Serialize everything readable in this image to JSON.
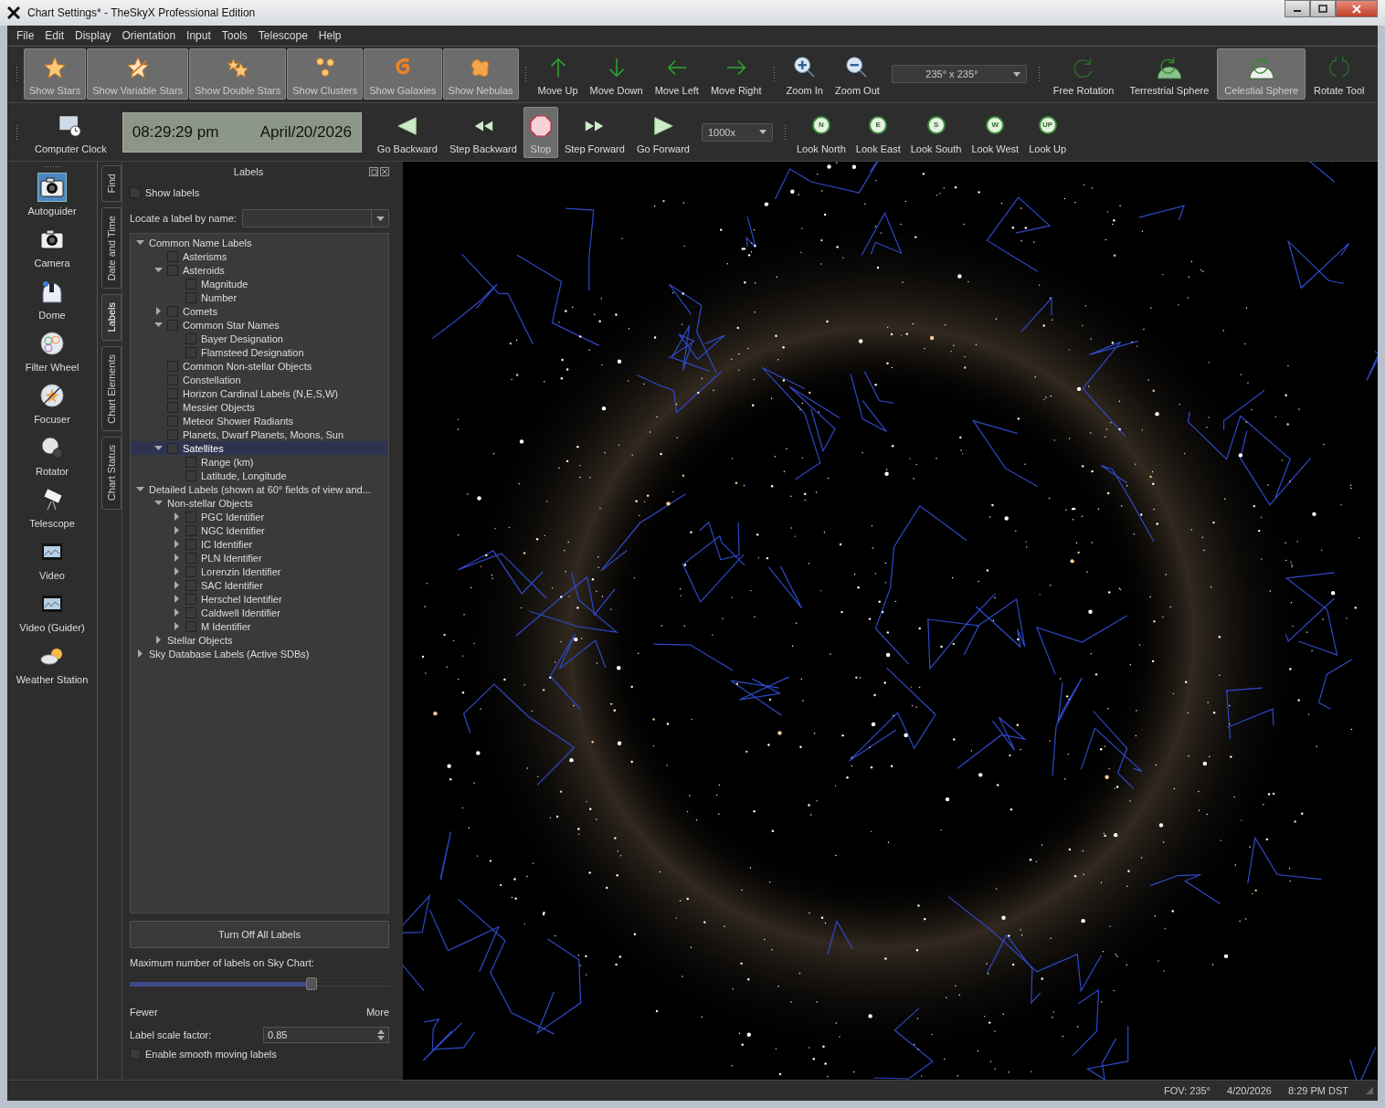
{
  "window": {
    "title": "Chart Settings* - TheSkyX Professional Edition"
  },
  "menu": [
    {
      "label": "File"
    },
    {
      "label": "Edit"
    },
    {
      "label": "Display"
    },
    {
      "label": "Orientation"
    },
    {
      "label": "Input"
    },
    {
      "label": "Tools"
    },
    {
      "label": "Telescope"
    },
    {
      "label": "Help"
    }
  ],
  "display_toggles": [
    {
      "label": "Show Stars",
      "kind": "star",
      "on": true
    },
    {
      "label": "Show Variable Stars",
      "kind": "variable",
      "on": true
    },
    {
      "label": "Show Double Stars",
      "kind": "double",
      "on": true
    },
    {
      "label": "Show Clusters",
      "kind": "cluster",
      "on": true
    },
    {
      "label": "Show Galaxies",
      "kind": "galaxy",
      "on": true
    },
    {
      "label": "Show Nebulas",
      "kind": "nebula",
      "on": true
    }
  ],
  "move_buttons": [
    {
      "label": "Move Up",
      "kind": "up"
    },
    {
      "label": "Move Down",
      "kind": "down"
    },
    {
      "label": "Move Left",
      "kind": "left"
    },
    {
      "label": "Move Right",
      "kind": "right"
    }
  ],
  "zoom_buttons": [
    {
      "label": "Zoom In",
      "kind": "in"
    },
    {
      "label": "Zoom Out",
      "kind": "out"
    }
  ],
  "fov_dropdown": {
    "value": "235° x 235°"
  },
  "rotation_modes": [
    {
      "label": "Free Rotation",
      "kind": "free",
      "selected": false
    },
    {
      "label": "Terrestrial Sphere",
      "kind": "sphere",
      "selected": false
    },
    {
      "label": "Celestial Sphere",
      "kind": "sphere",
      "selected": true
    },
    {
      "label": "Rotate Tool",
      "kind": "tool",
      "selected": false
    }
  ],
  "clock": {
    "label": "Computer Clock",
    "time": "08:29:29 pm",
    "date": "April/20/2026"
  },
  "playback": [
    {
      "label": "Go Backward",
      "kind": "back",
      "selected": false
    },
    {
      "label": "Step Backward",
      "kind": "stepback",
      "selected": false
    },
    {
      "label": "Stop",
      "kind": "stop",
      "selected": true
    },
    {
      "label": "Step Forward",
      "kind": "stepfwd",
      "selected": false
    },
    {
      "label": "Go Forward",
      "kind": "fwd",
      "selected": false
    }
  ],
  "rate_dropdown": {
    "value": "1000x"
  },
  "look_buttons": [
    {
      "label": "Look North",
      "badge": "N"
    },
    {
      "label": "Look East",
      "badge": "E"
    },
    {
      "label": "Look South",
      "badge": "S"
    },
    {
      "label": "Look West",
      "badge": "W"
    },
    {
      "label": "Look Up",
      "badge": "UP"
    }
  ],
  "side_tools": [
    {
      "label": "Autoguider",
      "kind": "camera",
      "selected": true
    },
    {
      "label": "Camera",
      "kind": "camera",
      "selected": false
    },
    {
      "label": "Dome",
      "kind": "dome",
      "selected": false
    },
    {
      "label": "Filter Wheel",
      "kind": "filter",
      "selected": false
    },
    {
      "label": "Focuser",
      "kind": "focuser",
      "selected": false
    },
    {
      "label": "Rotator",
      "kind": "rotator",
      "selected": false
    },
    {
      "label": "Telescope",
      "kind": "telescope",
      "selected": false
    },
    {
      "label": "Video",
      "kind": "video",
      "selected": false
    },
    {
      "label": "Video (Guider)",
      "kind": "video",
      "selected": false
    },
    {
      "label": "Weather Station",
      "kind": "weather",
      "selected": false
    }
  ],
  "vertical_tabs": [
    {
      "label": "Find",
      "selected": false
    },
    {
      "label": "Date and Time",
      "selected": false
    },
    {
      "label": "Labels",
      "selected": true
    },
    {
      "label": "Chart Elements",
      "selected": false
    },
    {
      "label": "Chart Status",
      "selected": false
    }
  ],
  "labels_panel": {
    "title": "Labels",
    "show_labels": {
      "label": "Show labels",
      "checked": false
    },
    "locate": {
      "label": "Locate a label by name:"
    },
    "tree": [
      {
        "label": "Common Name Labels",
        "kind": "group",
        "expanded": true,
        "selected": false,
        "children": [
          {
            "label": "Asterisms",
            "kind": "option",
            "checked": false,
            "selected": false
          },
          {
            "label": "Asteroids",
            "kind": "option",
            "checked": false,
            "expanded": true,
            "selected": false,
            "children": [
              {
                "label": "Magnitude",
                "kind": "option",
                "checked": false,
                "selected": false
              },
              {
                "label": "Number",
                "kind": "option",
                "checked": false,
                "selected": false
              }
            ]
          },
          {
            "label": "Comets",
            "kind": "option",
            "checked": false,
            "expanded": false,
            "selected": false
          },
          {
            "label": "Common Star Names",
            "kind": "option",
            "checked": false,
            "expanded": true,
            "selected": false,
            "children": [
              {
                "label": "Bayer Designation",
                "kind": "option",
                "checked": false,
                "selected": false
              },
              {
                "label": "Flamsteed Designation",
                "kind": "option",
                "checked": false,
                "selected": false
              }
            ]
          },
          {
            "label": "Common Non-stellar Objects",
            "kind": "option",
            "checked": false,
            "selected": false
          },
          {
            "label": "Constellation",
            "kind": "option",
            "checked": false,
            "selected": false
          },
          {
            "label": "Horizon Cardinal Labels (N,E,S,W)",
            "kind": "option",
            "checked": false,
            "selected": false
          },
          {
            "label": "Messier Objects",
            "kind": "option",
            "checked": false,
            "selected": false
          },
          {
            "label": "Meteor Shower Radiants",
            "kind": "option",
            "checked": false,
            "selected": false
          },
          {
            "label": "Planets, Dwarf Planets, Moons, Sun",
            "kind": "option",
            "checked": false,
            "selected": false
          },
          {
            "label": "Satellites",
            "kind": "option",
            "checked": false,
            "expanded": true,
            "selected": true,
            "children": [
              {
                "label": "Range (km)",
                "kind": "option",
                "checked": false,
                "selected": false
              },
              {
                "label": "Latitude, Longitude",
                "kind": "option",
                "checked": false,
                "selected": false
              }
            ]
          }
        ]
      },
      {
        "label": "Detailed Labels (shown at 60° fields of view and...",
        "kind": "group",
        "expanded": true,
        "selected": false,
        "children": [
          {
            "label": "Non-stellar Objects",
            "kind": "group",
            "expanded": true,
            "selected": false,
            "children": [
              {
                "label": "PGC Identifier",
                "kind": "option",
                "checked": false,
                "expanded": false,
                "selected": false
              },
              {
                "label": "NGC Identifier",
                "kind": "option",
                "checked": false,
                "expanded": false,
                "selected": false
              },
              {
                "label": "IC Identifier",
                "kind": "option",
                "checked": false,
                "expanded": false,
                "selected": false
              },
              {
                "label": "PLN Identifier",
                "kind": "option",
                "checked": false,
                "expanded": false,
                "selected": false
              },
              {
                "label": "Lorenzin Identifier",
                "kind": "option",
                "checked": false,
                "expanded": false,
                "selected": false
              },
              {
                "label": "SAC Identifier",
                "kind": "option",
                "checked": false,
                "expanded": false,
                "selected": false
              },
              {
                "label": "Herschel Identifier",
                "kind": "option",
                "checked": false,
                "expanded": false,
                "selected": false
              },
              {
                "label": "Caldwell Identifier",
                "kind": "option",
                "checked": false,
                "expanded": false,
                "selected": false
              },
              {
                "label": "M Identifier",
                "kind": "option",
                "checked": false,
                "expanded": false,
                "selected": false
              }
            ]
          },
          {
            "label": "Stellar Objects",
            "kind": "group",
            "expanded": false,
            "selected": false
          }
        ]
      },
      {
        "label": "Sky Database Labels (Active SDBs)",
        "kind": "group",
        "expanded": false,
        "selected": false
      }
    ],
    "turn_off_button": "Turn Off All Labels",
    "max_labels": {
      "label": "Maximum number of labels on Sky Chart:",
      "level": 0.7,
      "min_label": "Fewer",
      "max_label": "More"
    },
    "scale_factor": {
      "label": "Label scale factor:",
      "value": "0.85"
    },
    "smooth_labels": {
      "label": "Enable smooth moving labels",
      "checked": false
    }
  },
  "status_bar": [
    "FOV: 235°",
    "4/20/2026",
    "8:29 PM DST"
  ]
}
